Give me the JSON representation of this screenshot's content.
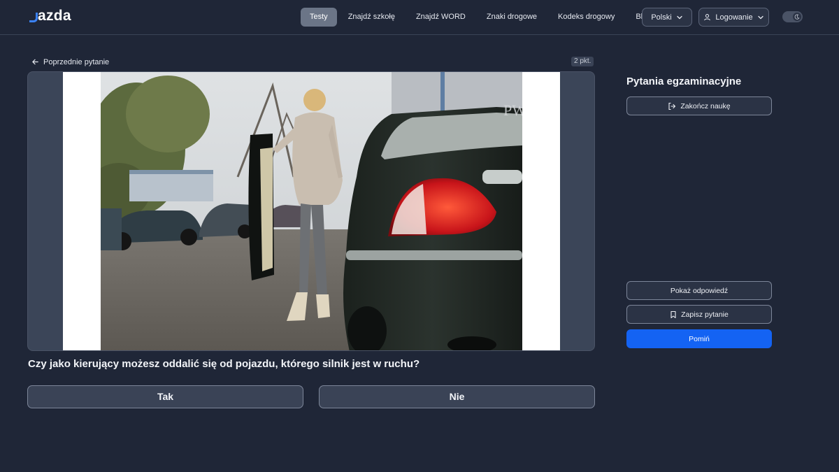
{
  "brand": {
    "logo_text": "azda",
    "accent": "#3b82f6"
  },
  "nav": {
    "items": [
      {
        "label": "Testy",
        "active": true
      },
      {
        "label": "Znajdź szkołę"
      },
      {
        "label": "Znajdź WORD"
      },
      {
        "label": "Znaki drogowe"
      },
      {
        "label": "Kodeks drogowy"
      },
      {
        "label": "Blog"
      }
    ],
    "language": "Polski",
    "login": "Logowanie"
  },
  "main": {
    "prev_link": "Poprzednie pytanie",
    "points": "2 pkt.",
    "image_watermark": "PWPW",
    "question": "Czy jako kierujący możesz oddalić się od pojazdu, którego silnik jest w ruchu?",
    "answers": {
      "yes": "Tak",
      "no": "Nie"
    }
  },
  "sidebar": {
    "title": "Pytania egzaminacyjne",
    "end_button": "Zakończ naukę",
    "show_answer": "Pokaż odpowiedź",
    "save_question": "Zapisz pytanie",
    "skip": "Pomiń",
    "skip_color": "#1463f3"
  },
  "icons": [
    "arrow-left-icon",
    "chevron-down-icon",
    "user-icon",
    "moon-icon",
    "logout-icon",
    "bookmark-icon"
  ]
}
